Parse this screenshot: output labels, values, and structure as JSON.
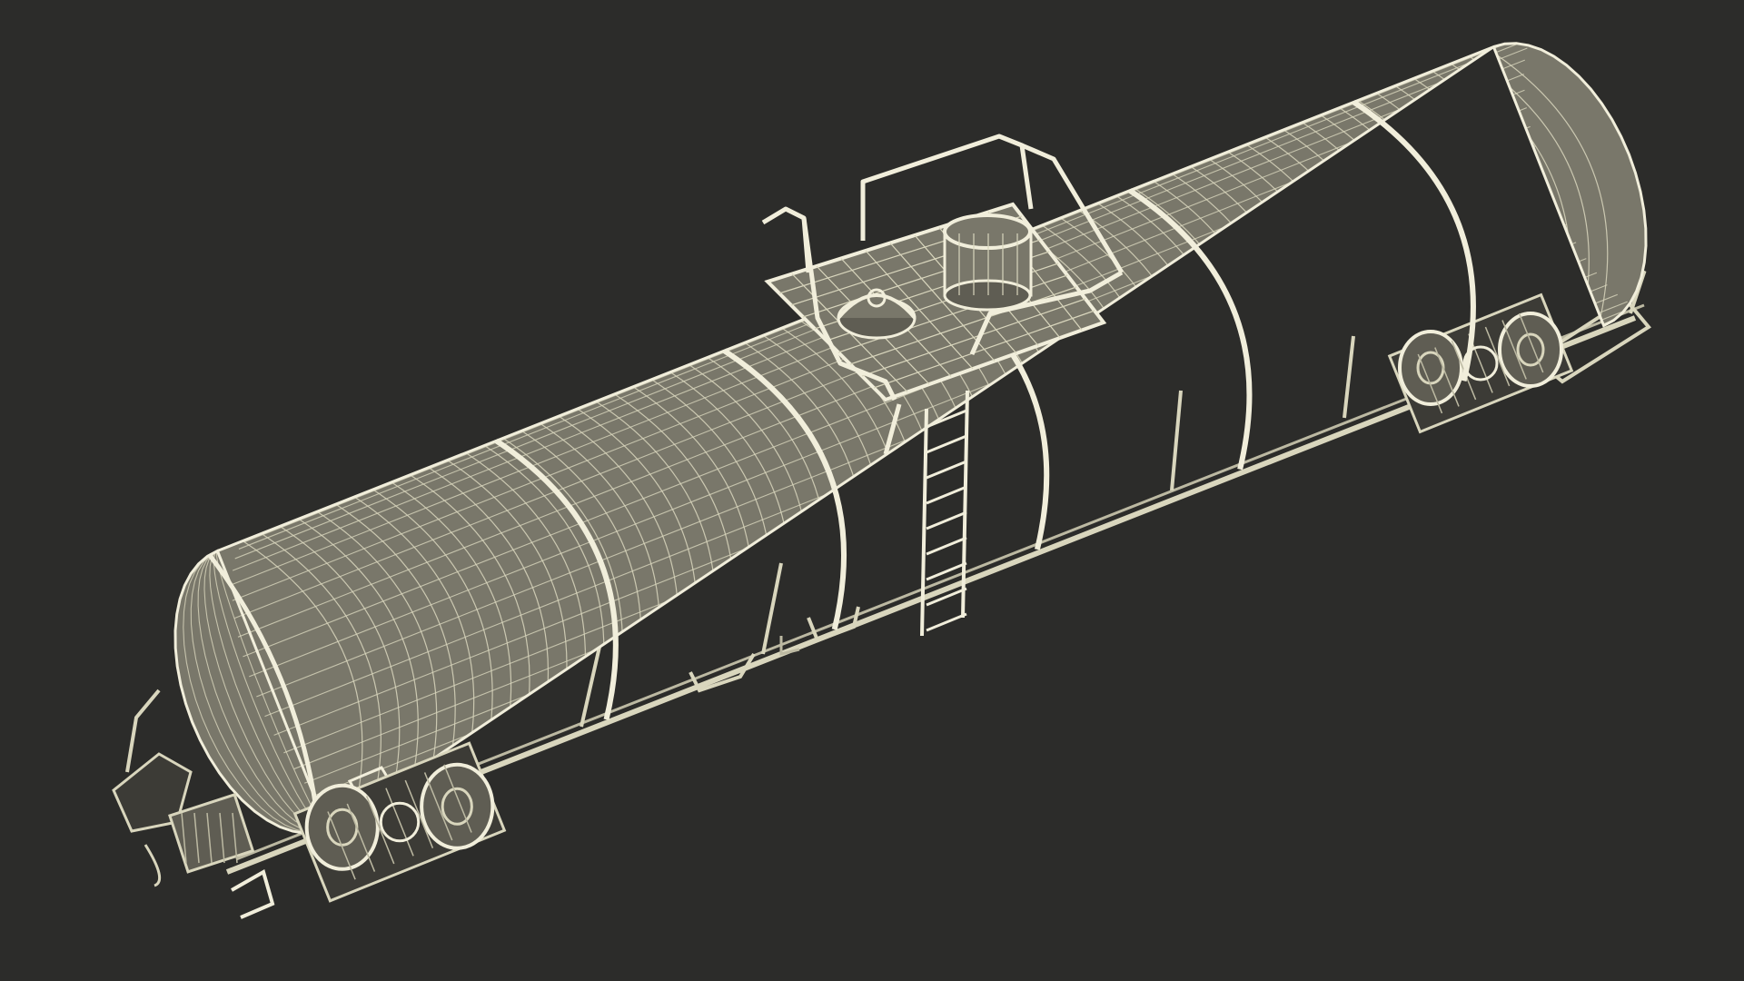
{
  "scene": {
    "subject": "tank-car-wireframe",
    "colors": {
      "background": "#2c2c2a",
      "tank_fill": "#79776a",
      "tank_fill_dark": "#5f5d53",
      "wire": "#d9d6bd",
      "wire_bright": "#f1eedb",
      "wire_dim": "#bcb9a2",
      "dark_part": "#3c3b36"
    }
  }
}
